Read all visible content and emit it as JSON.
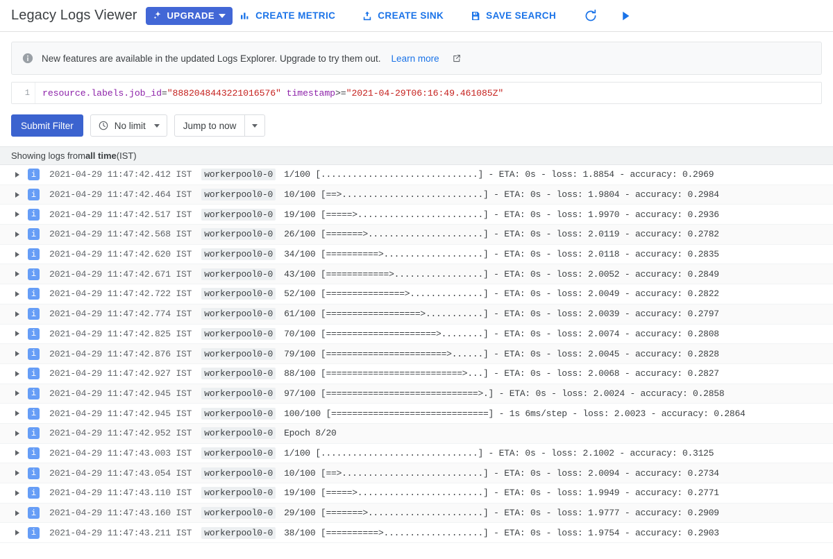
{
  "app": {
    "title": "Legacy Logs Viewer"
  },
  "toolbar": {
    "upgrade_label": "UPGRADE",
    "create_metric_label": "CREATE METRIC",
    "create_sink_label": "CREATE SINK",
    "save_search_label": "SAVE SEARCH",
    "refresh_name": "refresh",
    "play_name": "play",
    "accent_color": "#1a73e8",
    "upgrade_bg": "#4267d6"
  },
  "banner": {
    "icon": "info-icon",
    "text": "New features are available in the updated Logs Explorer. Upgrade to try them out.",
    "link_label": "Learn more",
    "external_icon": "external-link-icon"
  },
  "query": {
    "line_number": "1",
    "field": "resource.labels.job_id",
    "eq": "=",
    "job_id_value": "\"8882048443221016576\"",
    "second_field": "timestamp",
    "second_op": ">=",
    "timestamp_value": "\"2021-04-29T06:16:49.461085Z\"",
    "field_color": "#8e24aa",
    "string_color": "#c5221f"
  },
  "controls": {
    "submit_label": "Submit Filter",
    "limit_label": "No limit",
    "limit_icon": "clock-icon",
    "jump_label": "Jump to now",
    "submit_bg": "#3b63cf"
  },
  "status": {
    "prefix": "Showing logs from ",
    "emphasis": "all time",
    "suffix": " (IST)"
  },
  "logs": {
    "severity_icon": "info-severity-icon",
    "severity_letter": "i",
    "resource": "workerpool0-0",
    "rows": [
      {
        "timestamp": "2021-04-29 11:47:42.412 IST",
        "resource": "workerpool0-0",
        "message": "1/100 [..............................] - ETA: 0s - loss: 1.8854 - accuracy: 0.2969"
      },
      {
        "timestamp": "2021-04-29 11:47:42.464 IST",
        "resource": "workerpool0-0",
        "message": "10/100 [==>...........................] - ETA: 0s - loss: 1.9804 - accuracy: 0.2984"
      },
      {
        "timestamp": "2021-04-29 11:47:42.517 IST",
        "resource": "workerpool0-0",
        "message": "19/100 [=====>........................] - ETA: 0s - loss: 1.9970 - accuracy: 0.2936"
      },
      {
        "timestamp": "2021-04-29 11:47:42.568 IST",
        "resource": "workerpool0-0",
        "message": "26/100 [=======>......................] - ETA: 0s - loss: 2.0119 - accuracy: 0.2782"
      },
      {
        "timestamp": "2021-04-29 11:47:42.620 IST",
        "resource": "workerpool0-0",
        "message": "34/100 [==========>...................] - ETA: 0s - loss: 2.0118 - accuracy: 0.2835"
      },
      {
        "timestamp": "2021-04-29 11:47:42.671 IST",
        "resource": "workerpool0-0",
        "message": "43/100 [============>.................] - ETA: 0s - loss: 2.0052 - accuracy: 0.2849"
      },
      {
        "timestamp": "2021-04-29 11:47:42.722 IST",
        "resource": "workerpool0-0",
        "message": "52/100 [===============>..............] - ETA: 0s - loss: 2.0049 - accuracy: 0.2822"
      },
      {
        "timestamp": "2021-04-29 11:47:42.774 IST",
        "resource": "workerpool0-0",
        "message": "61/100 [==================>...........] - ETA: 0s - loss: 2.0039 - accuracy: 0.2797"
      },
      {
        "timestamp": "2021-04-29 11:47:42.825 IST",
        "resource": "workerpool0-0",
        "message": "70/100 [=====================>........] - ETA: 0s - loss: 2.0074 - accuracy: 0.2808"
      },
      {
        "timestamp": "2021-04-29 11:47:42.876 IST",
        "resource": "workerpool0-0",
        "message": "79/100 [=======================>......] - ETA: 0s - loss: 2.0045 - accuracy: 0.2828"
      },
      {
        "timestamp": "2021-04-29 11:47:42.927 IST",
        "resource": "workerpool0-0",
        "message": "88/100 [==========================>...] - ETA: 0s - loss: 2.0068 - accuracy: 0.2827"
      },
      {
        "timestamp": "2021-04-29 11:47:42.945 IST",
        "resource": "workerpool0-0",
        "message": "97/100 [=============================>.] - ETA: 0s - loss: 2.0024 - accuracy: 0.2858"
      },
      {
        "timestamp": "2021-04-29 11:47:42.945 IST",
        "resource": "workerpool0-0",
        "message": "100/100 [==============================] - 1s 6ms/step - loss: 2.0023 - accuracy: 0.2864"
      },
      {
        "timestamp": "2021-04-29 11:47:42.952 IST",
        "resource": "workerpool0-0",
        "message": "Epoch 8/20"
      },
      {
        "timestamp": "2021-04-29 11:47:43.003 IST",
        "resource": "workerpool0-0",
        "message": "1/100 [..............................] - ETA: 0s - loss: 2.1002 - accuracy: 0.3125"
      },
      {
        "timestamp": "2021-04-29 11:47:43.054 IST",
        "resource": "workerpool0-0",
        "message": "10/100 [==>...........................] - ETA: 0s - loss: 2.0094 - accuracy: 0.2734"
      },
      {
        "timestamp": "2021-04-29 11:47:43.110 IST",
        "resource": "workerpool0-0",
        "message": "19/100 [=====>........................] - ETA: 0s - loss: 1.9949 - accuracy: 0.2771"
      },
      {
        "timestamp": "2021-04-29 11:47:43.160 IST",
        "resource": "workerpool0-0",
        "message": "29/100 [=======>......................] - ETA: 0s - loss: 1.9777 - accuracy: 0.2909"
      },
      {
        "timestamp": "2021-04-29 11:47:43.211 IST",
        "resource": "workerpool0-0",
        "message": "38/100 [==========>...................] - ETA: 0s - loss: 1.9754 - accuracy: 0.2903"
      }
    ]
  }
}
